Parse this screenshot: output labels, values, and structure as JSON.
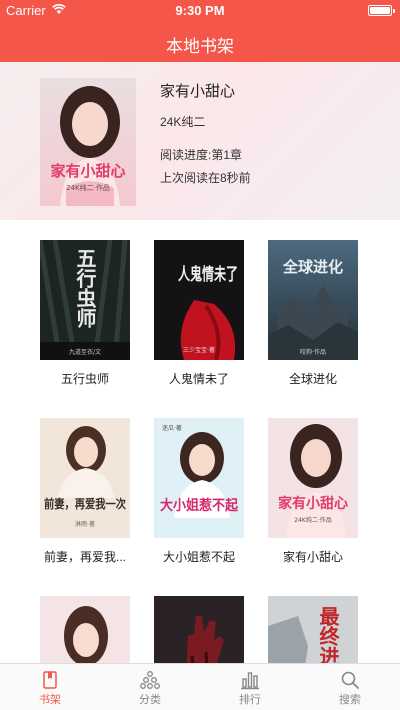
{
  "status_bar": {
    "carrier": "Carrier",
    "time": "9:30 PM"
  },
  "nav": {
    "title": "本地书架"
  },
  "recent": {
    "title": "家有小甜心",
    "author": "24K纯二",
    "progress": "阅读进度:第1章",
    "last_read": "上次阅读在8秒前",
    "cover": {
      "title": "家有小甜心",
      "byline": "24K纯二·作品"
    }
  },
  "books": [
    {
      "name": "五行虫师",
      "cover_title": "五行虫师",
      "cover_author": "九道至衣/文"
    },
    {
      "name": "人鬼情未了",
      "cover_title": "人鬼情未了",
      "cover_author": "三少宝宝·著"
    },
    {
      "name": "全球进化",
      "cover_title": "全球进化",
      "cover_author": "咬狗·作品"
    },
    {
      "name": "前妻，再爱我...",
      "cover_title": "前妻，再爱我一次",
      "cover_author": "淋雨·著"
    },
    {
      "name": "大小姐惹不起",
      "cover_title": "大小姐惹不起",
      "cover_author": "迷瓜·著"
    },
    {
      "name": "家有小甜心",
      "cover_title": "家有小甜心",
      "cover_author": "24K纯二·作品"
    },
    {
      "name": "",
      "cover_title": "",
      "cover_author": ""
    },
    {
      "name": "",
      "cover_title": "",
      "cover_author": ""
    },
    {
      "name": "",
      "cover_title": "最终进",
      "cover_author": ""
    }
  ],
  "tabs": [
    {
      "label": "书架",
      "icon": "bookshelf-icon",
      "active": true
    },
    {
      "label": "分类",
      "icon": "category-icon",
      "active": false
    },
    {
      "label": "排行",
      "icon": "ranking-icon",
      "active": false
    },
    {
      "label": "搜索",
      "icon": "search-icon",
      "active": false
    }
  ],
  "colors": {
    "accent": "#f4564a",
    "tab_inactive": "#888888"
  }
}
